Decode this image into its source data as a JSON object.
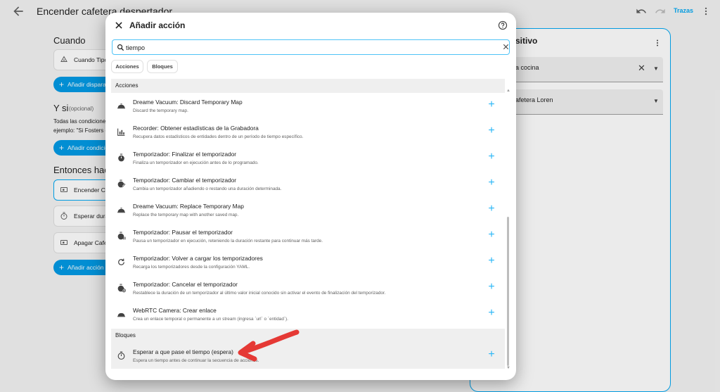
{
  "app": {
    "title": "Encender cafetera despertador",
    "trazas": "Trazas"
  },
  "background": {
    "cuando": "Cuando",
    "trigger_label": "Cuando Tipo",
    "add_trigger": "Añadir dispara",
    "y_si": "Y si",
    "opcional": "(opcional)",
    "conditions_note_1": "Todas las condicione",
    "conditions_note_2": "ejemplo: \"Si Fosters c",
    "add_condition": "Añadir condicio",
    "entonces": "Entonces hace",
    "actions": [
      {
        "label": "Encender Caf",
        "icon": "device-icon"
      },
      {
        "label": "Esperar dura",
        "icon": "timer-icon"
      },
      {
        "label": "Apagar Cafet",
        "icon": "device-icon"
      }
    ],
    "add_action": "Añadir acción",
    "panel": {
      "title": "sitivo",
      "field1_value": "a cocina",
      "field2_value": "afetera Loren"
    }
  },
  "dialog": {
    "title": "Añadir acción",
    "search": {
      "value": "tiempo",
      "placeholder": ""
    },
    "chips": [
      "Acciones",
      "Bloques"
    ],
    "groups": {
      "acciones": "Acciones",
      "bloques": "Bloques"
    },
    "items": [
      {
        "title": "Dreame Vacuum: Discard Temporary Map",
        "desc": "Discard the temporary map.",
        "icon": "vacuum-icon"
      },
      {
        "title": "Recorder: Obtener estadísticas de la Grabadora",
        "desc": "Recupera datos estadísticos de entidades dentro de un período de tiempo específico.",
        "icon": "chart-icon"
      },
      {
        "title": "Temporizador: Finalizar el temporizador",
        "desc": "Finaliza un temporizador en ejecución antes de lo programado.",
        "icon": "timer-icon"
      },
      {
        "title": "Temporizador: Cambiar el temporizador",
        "desc": "Cambia un temporizador añadiendo o restando una duración determinada.",
        "icon": "timer-edit-icon"
      },
      {
        "title": "Dreame Vacuum: Replace Temporary Map",
        "desc": "Replace the temporary map with another saved map.",
        "icon": "vacuum-icon"
      },
      {
        "title": "Temporizador: Pausar el temporizador",
        "desc": "Pausa un temporizador en ejecución, reteniendo la duración restante para continuar más tarde.",
        "icon": "timer-pause-icon"
      },
      {
        "title": "Temporizador: Volver a cargar los temporizadores",
        "desc": "Recarga los temporizadores desde la configuración YAML.",
        "icon": "reload-icon"
      },
      {
        "title": "Temporizador: Cancelar el temporizador",
        "desc": "Restablece la duración de un temporizador al último valor inicial conocido sin activar el evento de finalización del temporizador.",
        "icon": "timer-cancel-icon"
      },
      {
        "title": "WebRTC Camera: Crear enlace",
        "desc": "Crea un enlace temporal o permanente a un stream (ingresa `url` o `entidad`).",
        "icon": "camera-icon"
      }
    ],
    "bloques_items": [
      {
        "title": "Esperar a que pase el tiempo (espera)",
        "desc": "Espera un tiempo antes de continuar la secuencia de acciones.",
        "icon": "timer-icon"
      }
    ]
  },
  "colors": {
    "accent": "#03a9f4",
    "plus": "#29b6f6",
    "annotation_arrow": "#e53935"
  }
}
